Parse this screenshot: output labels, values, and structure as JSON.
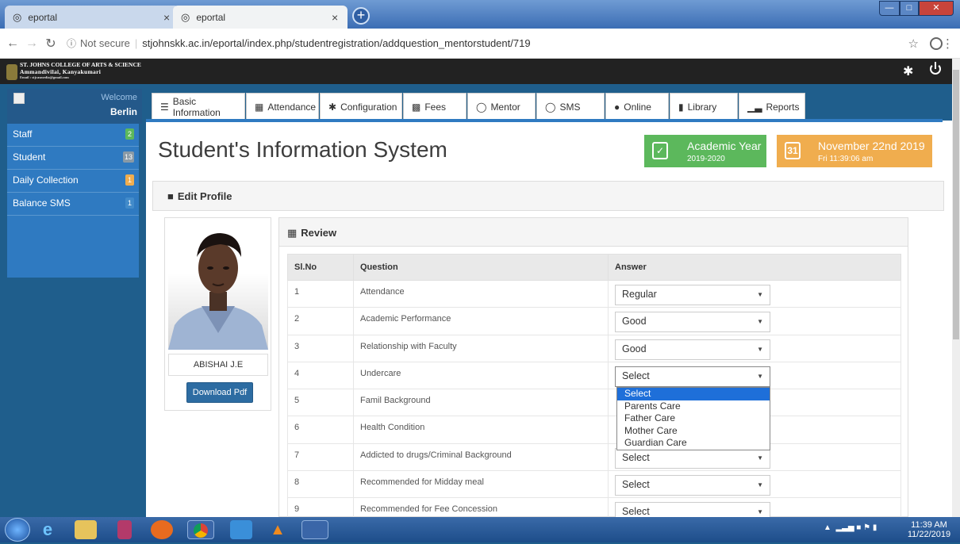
{
  "browser": {
    "tabs": [
      {
        "label": "eportal"
      },
      {
        "label": "eportal"
      }
    ],
    "security": "Not secure",
    "url": "stjohnskk.ac.in/eportal/index.php/studentregistration/addquestion_mentorstudent/719"
  },
  "college": {
    "name": "ST. JOHNS COLLEGE OF ARTS & SCIENCE",
    "place": "Ammandivilai, Kanyakumari",
    "email": "Email : stjcasmedia@gmail.com"
  },
  "user": {
    "welcome": "Welcome",
    "name": "Berlin"
  },
  "sidebar": {
    "items": [
      {
        "label": "Staff",
        "count": "2",
        "color": "#5cb85c"
      },
      {
        "label": "Student",
        "count": "13",
        "color": "#777777"
      },
      {
        "label": "Daily Collection",
        "count": "1",
        "color": "#f0ad4e"
      },
      {
        "label": "Balance SMS",
        "count": "1",
        "color": "#428bca"
      }
    ]
  },
  "menu": [
    {
      "label": "Basic Information",
      "icon": "list-icon"
    },
    {
      "label": "Attendance",
      "icon": "table-icon"
    },
    {
      "label": "Configuration",
      "icon": "gear-icon"
    },
    {
      "label": "Fees",
      "icon": "wallet-icon"
    },
    {
      "label": "Mentor",
      "icon": "comment-icon"
    },
    {
      "label": "SMS",
      "icon": "comment-icon"
    },
    {
      "label": "Online",
      "icon": "user-icon"
    },
    {
      "label": "Library",
      "icon": "book-icon"
    },
    {
      "label": "Reports",
      "icon": "bar-chart-icon"
    }
  ],
  "page": {
    "title": "Student's Information System",
    "academic_label": "Academic Year",
    "academic_value": "2019-2020",
    "date": "November 22nd 2019",
    "datetime": "Fri 11:39:06 am",
    "edit_profile": "Edit Profile",
    "review": "Review"
  },
  "student": {
    "name": "ABISHAI J.E",
    "download_label": "Download Pdf"
  },
  "table": {
    "headers": [
      "Sl.No",
      "Question",
      "Answer"
    ],
    "rows": [
      {
        "no": "1",
        "question": "Attendance",
        "answer": "Regular"
      },
      {
        "no": "2",
        "question": "Academic Performance",
        "answer": "Good"
      },
      {
        "no": "3",
        "question": "Relationship with Faculty",
        "answer": "Good"
      },
      {
        "no": "4",
        "question": "Undercare",
        "answer": "Select"
      },
      {
        "no": "5",
        "question": "Famil Background",
        "answer": ""
      },
      {
        "no": "6",
        "question": "Health Condition",
        "answer": ""
      },
      {
        "no": "7",
        "question": "Addicted to drugs/Criminal Background",
        "answer": "Select"
      },
      {
        "no": "8",
        "question": "Recommended for Midday meal",
        "answer": "Select"
      },
      {
        "no": "9",
        "question": "Recommended for Fee Concession",
        "answer": "Select"
      }
    ]
  },
  "dropdown": {
    "options": [
      "Select",
      "Parents Care",
      "Father Care",
      "Mother Care",
      "Guardian Care"
    ],
    "highlighted": "Select"
  },
  "taskbar": {
    "time": "11:39 AM",
    "date": "11/22/2019"
  }
}
